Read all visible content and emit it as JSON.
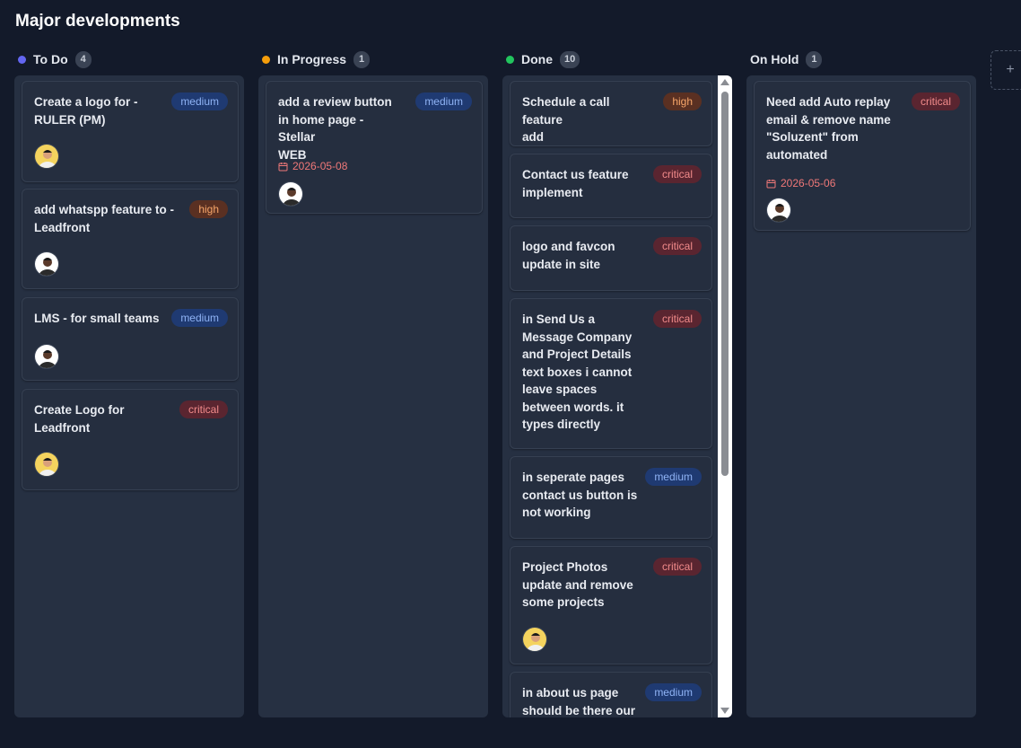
{
  "board": {
    "title": "Major developments"
  },
  "columns": [
    {
      "name": "To Do",
      "count": "4",
      "color": "#6366f1",
      "cards": [
        {
          "title": "Create a logo for -\nRULER (PM)",
          "priority": "medium",
          "avatar": "yellow"
        },
        {
          "title": "add whatspp feature to -\nLeadfront",
          "priority": "high",
          "avatar": "white"
        },
        {
          "title": "LMS - for small teams",
          "priority": "medium",
          "avatar": "white"
        },
        {
          "title": "Create Logo for\nLeadfront",
          "priority": "critical",
          "avatar": "yellow"
        }
      ]
    },
    {
      "name": "In Progress",
      "count": "1",
      "color": "#f59e0b",
      "cards": [
        {
          "title": "add a review button\nin home page - Stellar\nWEB",
          "priority": "medium",
          "date": "2026-05-08",
          "avatar": "white"
        }
      ]
    },
    {
      "name": "Done",
      "count": "10",
      "color": "#22c55e",
      "cards": [
        {
          "title": "Schedule a call feature\nadd",
          "priority": "high"
        },
        {
          "title": "Contact us feature\nimplement",
          "priority": "critical"
        },
        {
          "title": "logo and favcon\nupdate in site",
          "priority": "critical"
        },
        {
          "title": "in Send Us a\nMessage Company\nand Project Details\ntext boxes i cannot\nleave spaces\nbetween words. it\ntypes directly",
          "priority": "critical"
        },
        {
          "title": "in seperate pages\ncontact us button is\nnot working",
          "priority": "medium"
        },
        {
          "title": "Project Photos\nupdate and remove\nsome projects",
          "priority": "critical",
          "avatar": "yellow"
        },
        {
          "title": "in about us page\nshould be there our",
          "priority": "medium"
        }
      ]
    },
    {
      "name": "On Hold",
      "count": "1",
      "color": "#4b5563",
      "cards": [
        {
          "title": "Need add Auto replay\nemail & remove name\n\"Soluzent\" from\nautomated",
          "priority": "critical",
          "date": "2026-05-06",
          "avatar": "white"
        }
      ]
    }
  ],
  "add_column": {
    "icon": "plus-icon",
    "label": "+"
  },
  "colors": {
    "medium": "#8fb3f5",
    "high": "#f7a569",
    "critical": "#f28b8b",
    "date": "#f07878"
  }
}
